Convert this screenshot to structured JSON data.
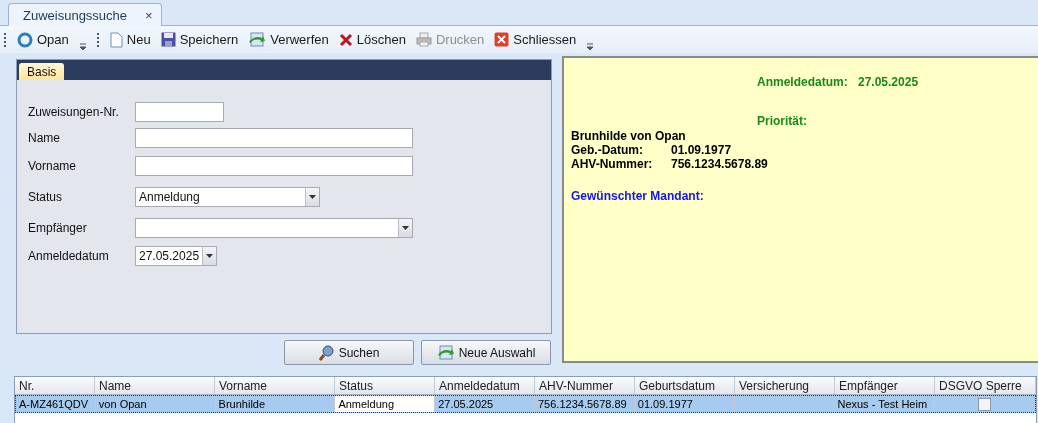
{
  "document_tab": {
    "label": "Zuweisungssuche",
    "close": "×",
    "selected": true
  },
  "toolbar": [
    {
      "kind": "logo",
      "label": "Opan",
      "disabled": false,
      "dropdown": true
    },
    {
      "kind": "new",
      "label": "Neu",
      "disabled": false
    },
    {
      "kind": "save",
      "label": "Speichern",
      "disabled": false
    },
    {
      "kind": "discard",
      "label": "Verwerfen",
      "disabled": false
    },
    {
      "kind": "delete",
      "label": "Löschen",
      "disabled": false
    },
    {
      "kind": "print",
      "label": "Drucken",
      "disabled": true
    },
    {
      "kind": "close",
      "label": "Schliessen",
      "disabled": false
    }
  ],
  "form": {
    "tab": {
      "label": "Basis",
      "selected": true
    },
    "fields": [
      {
        "kind": "text",
        "label": "Zuweisungen-Nr."
      },
      {
        "kind": "text",
        "label": "Name"
      },
      {
        "kind": "text",
        "label": "Vorname"
      },
      {
        "kind": "select",
        "label": "Status",
        "value": "Anmeldung"
      },
      {
        "kind": "select",
        "label": "Empfänger"
      },
      {
        "kind": "date",
        "label": "Anmeldedatum",
        "value": "27.05.2025"
      }
    ]
  },
  "buttons": [
    {
      "kind": "search",
      "label": "Suchen"
    },
    {
      "kind": "reset",
      "label": "Neue Auswahl"
    }
  ],
  "summary": {
    "header": [
      {
        "label": "Anmeldedatum:",
        "value": "27.05.2025"
      },
      {
        "label": "Priorität:"
      }
    ],
    "person": "Brunhilde von Opan",
    "details": [
      {
        "label": "Geb.-Datum:",
        "value": "01.09.1977"
      },
      {
        "label": "AHV-Nummer:",
        "value": "756.1234.5678.89"
      }
    ],
    "mandant": "Gewünschter Mandant:"
  },
  "table": {
    "columns": [
      "Nr.",
      "Name",
      "Vorname",
      "Status",
      "Anmeldedatum",
      "AHV-Nummer",
      "Geburtsdatum",
      "Versicherung",
      "Empfänger",
      "DSGVO Sperre"
    ],
    "rows": [
      {
        "selected": true,
        "dsgvo_checked": false,
        "cells": [
          {
            "text": "A-MZ461QDV",
            "focused": false
          },
          {
            "text": "von Opan",
            "focused": false
          },
          {
            "text": "Brunhilde",
            "focused": false
          },
          {
            "text": "Anmeldung",
            "focused": true
          },
          {
            "text": "27.05.2025",
            "focused": false
          },
          {
            "text": "756.1234.5678.89",
            "focused": false
          },
          {
            "text": "01.09.1977",
            "focused": false
          },
          {
            "focused": false
          },
          {
            "text": "Nexus - Test Heim",
            "focused": false
          }
        ]
      }
    ]
  }
}
